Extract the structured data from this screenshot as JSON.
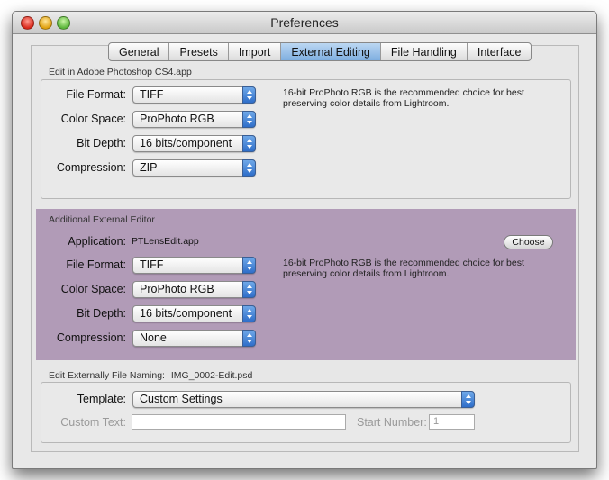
{
  "window": {
    "title": "Preferences"
  },
  "tabs": [
    {
      "label": "General"
    },
    {
      "label": "Presets"
    },
    {
      "label": "Import"
    },
    {
      "label": "External Editing",
      "active": true
    },
    {
      "label": "File Handling"
    },
    {
      "label": "Interface"
    }
  ],
  "photoshop": {
    "group_label": "Edit in Adobe Photoshop CS4.app",
    "file_format_label": "File Format:",
    "file_format": "TIFF",
    "color_space_label": "Color Space:",
    "color_space": "ProPhoto RGB",
    "bit_depth_label": "Bit Depth:",
    "bit_depth": "16 bits/component",
    "compression_label": "Compression:",
    "compression": "ZIP",
    "note": "16-bit ProPhoto RGB is the recommended choice for best preserving color details from Lightroom."
  },
  "additional": {
    "group_label": "Additional External Editor",
    "application_label": "Application:",
    "application": "PTLensEdit.app",
    "choose_label": "Choose",
    "file_format_label": "File Format:",
    "file_format": "TIFF",
    "color_space_label": "Color Space:",
    "color_space": "ProPhoto RGB",
    "bit_depth_label": "Bit Depth:",
    "bit_depth": "16 bits/component",
    "compression_label": "Compression:",
    "compression": "None",
    "note": "16-bit ProPhoto RGB is the recommended choice for best preserving color details from Lightroom.",
    "highlight_color": "#b19bb7"
  },
  "naming": {
    "group_label": "Edit Externally File Naming:",
    "example": "IMG_0002-Edit.psd",
    "template_label": "Template:",
    "template": "Custom Settings",
    "custom_text_label": "Custom Text:",
    "custom_text_value": "",
    "start_number_label": "Start Number:",
    "start_number": "1"
  }
}
